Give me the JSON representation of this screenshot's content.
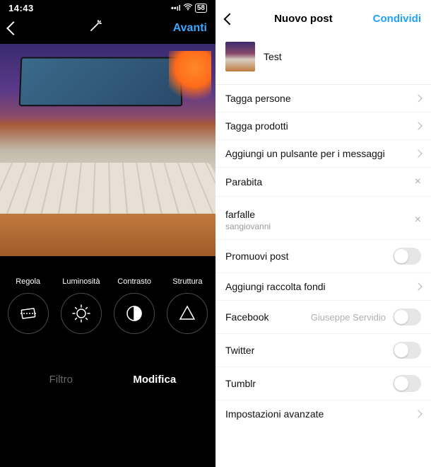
{
  "left": {
    "status": {
      "time": "14:43",
      "battery": "58"
    },
    "nav": {
      "next": "Avanti"
    },
    "tools": [
      {
        "label": "Regola",
        "icon": "adjust-icon"
      },
      {
        "label": "Luminosità",
        "icon": "brightness-icon"
      },
      {
        "label": "Contrasto",
        "icon": "contrast-icon"
      },
      {
        "label": "Struttura",
        "icon": "structure-icon"
      }
    ],
    "tabs": {
      "filter": "Filtro",
      "edit": "Modifica",
      "active": "edit"
    }
  },
  "right": {
    "nav": {
      "title": "Nuovo post",
      "share": "Condividi"
    },
    "caption": "Test",
    "rows": {
      "tag_people": "Tagga persone",
      "tag_products": "Tagga prodotti",
      "add_msg_button": "Aggiungi un pulsante per i messaggi",
      "location": "Parabita",
      "music_title": "farfalle",
      "music_artist": "sangiovanni",
      "promote": "Promuovi post",
      "fundraiser": "Aggiungi raccolta fondi",
      "facebook": "Facebook",
      "facebook_account": "Giuseppe Servidio",
      "twitter": "Twitter",
      "tumblr": "Tumblr",
      "advanced": "Impostazioni avanzate"
    }
  }
}
